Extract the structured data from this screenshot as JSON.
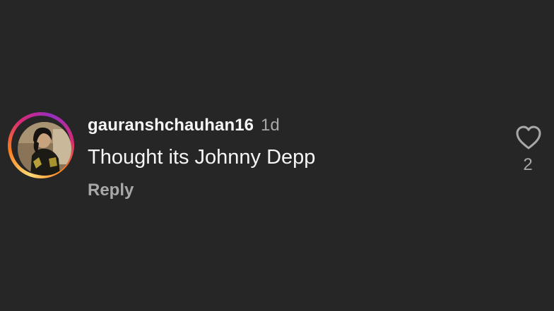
{
  "comment": {
    "username": "gauranshchauhan16",
    "time": "1d",
    "text": "Thought its Johnny Depp",
    "reply_label": "Reply",
    "like_count": "2",
    "avatar_has_story_ring": true
  },
  "icons": {
    "like": "heart-outline-icon"
  },
  "colors": {
    "background": "#262626",
    "primary_text": "#f5f5f5",
    "secondary_text": "#a8a8a8",
    "story_ring": [
      "#feda75",
      "#fa7e1e",
      "#d62976",
      "#962fbf"
    ]
  }
}
